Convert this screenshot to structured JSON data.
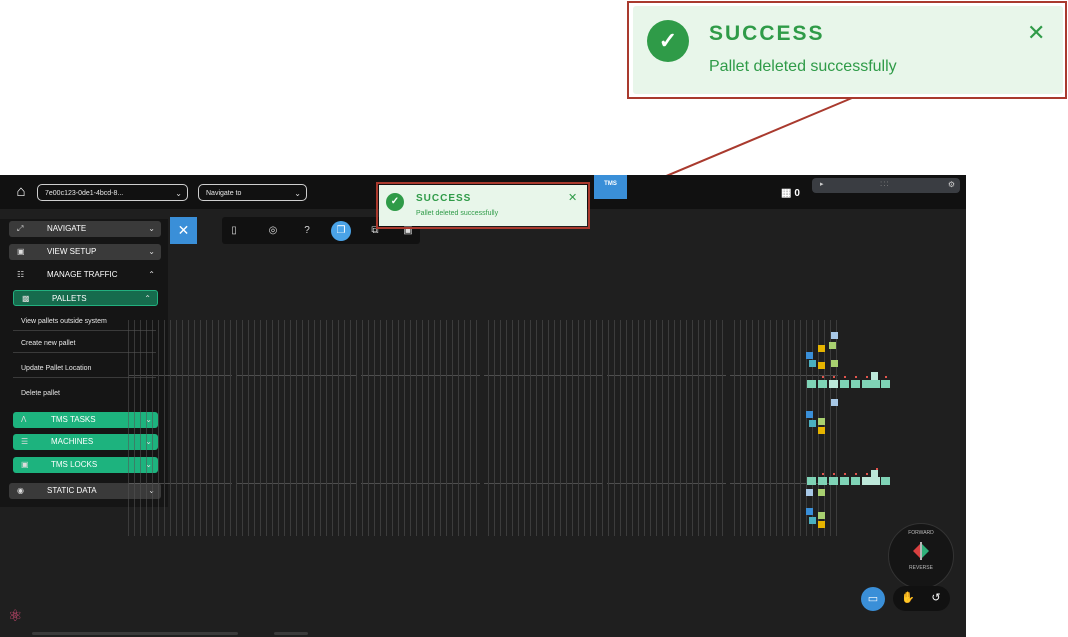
{
  "topbar": {
    "uuid_select": "7e00c123-0de1-4bcd-8...",
    "navigate_placeholder": "Navigate to",
    "tms_tab": "TMS",
    "pallet_count": "0"
  },
  "sidebar": {
    "navigate": "NAVIGATE",
    "view_setup": "VIEW SETUP",
    "manage_traffic": "MANAGE TRAFFIC",
    "pallets": "PALLETS",
    "pallet_items": [
      "View pallets outside system",
      "Create new pallet",
      "Update Pallet Location",
      "Delete pallet"
    ],
    "tms_tasks": "TMS TASKS",
    "machines": "MACHINES",
    "tms_locks": "TMS LOCKS",
    "static_data": "STATIC DATA"
  },
  "direction_control": {
    "forward": "FORWARD",
    "reverse": "REVERSE"
  },
  "toast": {
    "title": "SUCCESS",
    "message": "Pallet deleted successfully"
  },
  "colors": {
    "accent_blue": "#3a8fd8",
    "accent_green": "#1db37e",
    "success_bg": "#e8f6ea",
    "success_text": "#2f9b48",
    "highlight_frame": "#a93a2e"
  }
}
